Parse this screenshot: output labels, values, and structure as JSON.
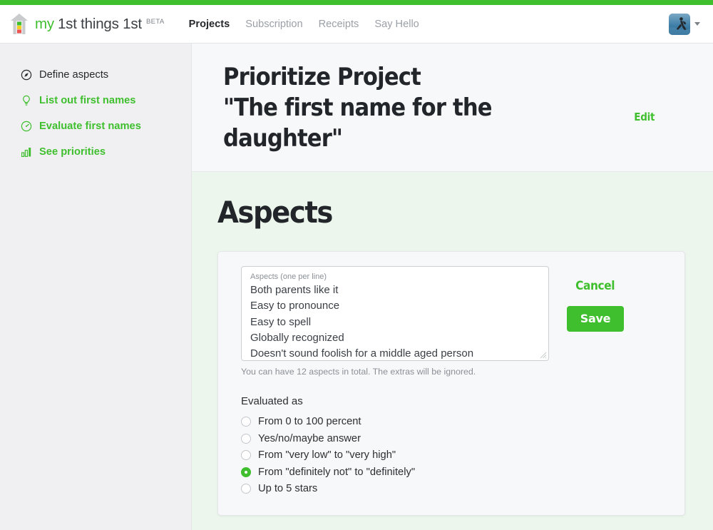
{
  "theme": {
    "brand_green": "#3fbf2e",
    "top_strip": "#3fbf2e",
    "header_bg": "#f7f8f9",
    "aspects_bg": "#ecf6ec",
    "sidebar_bg": "#f0f0f3",
    "card_bg": "#f7f8f9",
    "text_dark": "#22262a",
    "text_muted": "#8b9097"
  },
  "header": {
    "brand_my": "my",
    "brand_rest": "1st things 1st",
    "brand_beta": "BETA",
    "logo_icon": "house-bars-logo-icon",
    "nav": [
      {
        "label": "Projects",
        "active": true
      },
      {
        "label": "Subscription",
        "active": false
      },
      {
        "label": "Receipts",
        "active": false
      },
      {
        "label": "Say Hello",
        "active": false
      }
    ],
    "avatar_icon": "user-avatar",
    "caret_icon": "chevron-down-icon"
  },
  "sidebar": {
    "items": [
      {
        "label": "Define aspects",
        "icon": "compass-icon",
        "state": "current"
      },
      {
        "label": "List out first names",
        "icon": "lightbulb-icon",
        "state": "link"
      },
      {
        "label": "Evaluate first names",
        "icon": "gauge-icon",
        "state": "link"
      },
      {
        "label": "See priorities",
        "icon": "bar-chart-icon",
        "state": "link"
      }
    ]
  },
  "project": {
    "title_line1": "Prioritize Project",
    "title_line2": "\"The first name for the",
    "title_line3": "daughter\"",
    "edit_label": "Edit"
  },
  "aspects": {
    "section_title": "Aspects",
    "textarea_label": "Aspects (one per line)",
    "textarea_value": "Both parents like it\nEasy to pronounce\nEasy to spell\nGlobally recognized\nDoesn't sound foolish for a middle aged person",
    "help_text": "You can have 12 aspects in total. The extras will be ignored.",
    "evaluated_label": "Evaluated as",
    "options": [
      {
        "label": "From 0 to 100 percent",
        "selected": false
      },
      {
        "label": "Yes/no/maybe answer",
        "selected": false
      },
      {
        "label": "From \"very low\" to \"very high\"",
        "selected": false
      },
      {
        "label": "From \"definitely not\" to \"definitely\"",
        "selected": true
      },
      {
        "label": "Up to 5 stars",
        "selected": false
      }
    ],
    "cancel_label": "Cancel",
    "save_label": "Save"
  }
}
